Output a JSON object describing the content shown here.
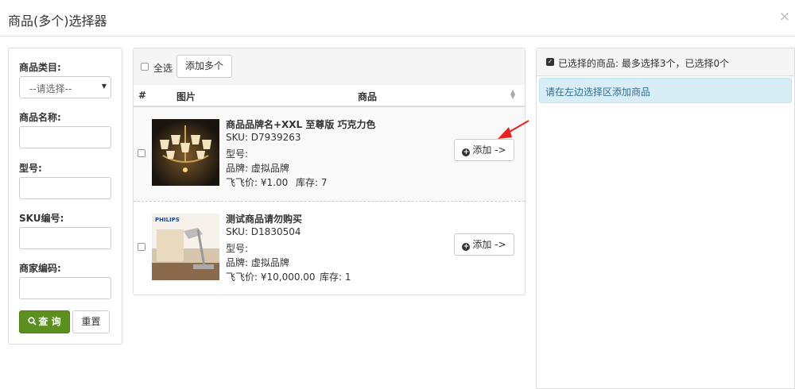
{
  "dialog": {
    "title": "商品(多个)选择器",
    "close_glyph": "×"
  },
  "filter": {
    "category_label": "商品类目:",
    "category_selected": "--请选择--",
    "name_label": "商品名称:",
    "model_label": "型号:",
    "sku_label": "SKU编号:",
    "merchant_code_label": "商家编码:",
    "query_label": "查 询",
    "reset_label": "重置",
    "query_color": "#5b8f1e"
  },
  "list": {
    "select_all_label": "全选",
    "add_multi_label": "添加多个",
    "col_index": "#",
    "col_image": "图片",
    "col_product": "商品",
    "add_label": "添加 ->",
    "products": [
      {
        "name": "商品品牌名+XXL 至尊版 巧克力色",
        "sku": "SKU: D7939263",
        "model": "型号:",
        "brand": "品牌: 虚拟品牌",
        "price": "飞飞价: ¥1.00",
        "stock": "库存: 7",
        "image": "chandelier"
      },
      {
        "name": "测试商品请勿购买",
        "sku": "SKU: D1830504",
        "model": "型号:",
        "brand": "品牌: 虚拟品牌",
        "price": "飞飞价: ¥10,000.00",
        "stock": "库存: 1",
        "image": "philips-desk-lamp",
        "image_text": "PHILIPS"
      }
    ]
  },
  "selected": {
    "title": "已选择的商品:  最多选择3个，已选择0个",
    "hint": "请在左边选择区添加商品",
    "hint_bg": "#d9edf7"
  },
  "annotation": {
    "color": "#e8231b"
  }
}
